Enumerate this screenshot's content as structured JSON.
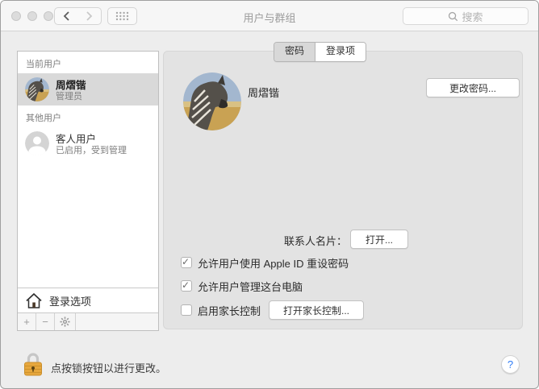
{
  "window": {
    "title": "用户与群组",
    "search_placeholder": "搜索"
  },
  "tabs": {
    "password": "密码",
    "login_items": "登录项",
    "selected": "密码"
  },
  "sidebar": {
    "current_user_header": "当前用户",
    "current_user": {
      "name": "周熠锴",
      "role": "管理员"
    },
    "other_users_header": "其他用户",
    "guest_user": {
      "name": "客人用户",
      "status": "已启用，受到管理"
    },
    "login_options_label": "登录选项",
    "add_label": "+",
    "remove_label": "−"
  },
  "main": {
    "user_name": "周熠锴",
    "change_password_button": "更改密码...",
    "contacts_card_label": "联系人名片：",
    "open_button": "打开...",
    "checkboxes": [
      {
        "label": "允许用户使用 Apple ID 重设密码",
        "checked": true
      },
      {
        "label": "允许用户管理这台电脑",
        "checked": true
      },
      {
        "label": "启用家长控制",
        "checked": false
      }
    ],
    "parental_controls_button": "打开家长控制..."
  },
  "footer": {
    "lock_text": "点按锁按钮以进行更改。",
    "help_label": "?"
  },
  "colors": {
    "selection_gray": "#d9d9d9",
    "pane_bg": "#e3e3e3",
    "lock_body": "#e8a83e",
    "help_blue": "#2f7cf6"
  }
}
